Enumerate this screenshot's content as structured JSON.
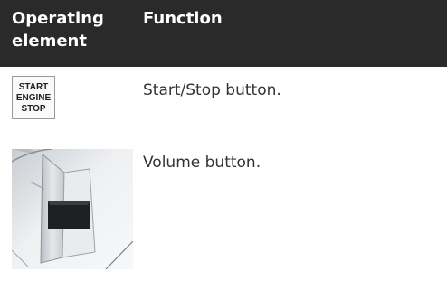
{
  "table": {
    "header": {
      "col1": "Operating element",
      "col2": "Function"
    },
    "rows": [
      {
        "image_icon": "start-engine-stop-button-icon",
        "button_lines": [
          "START",
          "ENGINE",
          "STOP"
        ],
        "function": "Start/Stop button."
      },
      {
        "image_icon": "volume-button-photo",
        "function": "Volume button."
      }
    ]
  }
}
